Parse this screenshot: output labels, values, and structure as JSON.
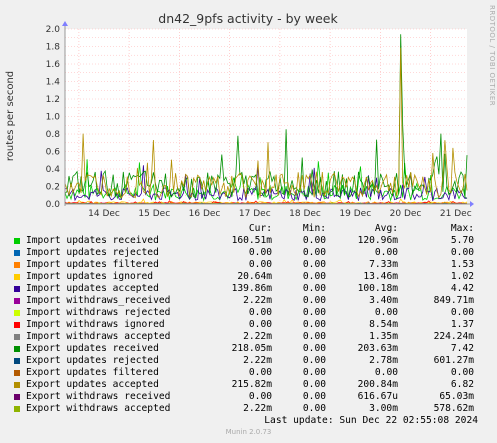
{
  "side_label": "RRDTOOL / TOBI OETIKER",
  "footer": "Munin 2.0.73",
  "chart_data": {
    "type": "line",
    "title": "dn42_9pfs activity - by week",
    "ylabel": "routes per second",
    "xlabel": "",
    "ylim": [
      0,
      2.0
    ],
    "yticks": [
      "0.0",
      "0.2",
      "0.4",
      "0.6",
      "0.8",
      "1.0",
      "1.2",
      "1.4",
      "1.6",
      "1.8",
      "2.0"
    ],
    "x_tick_labels": [
      "14 Dec",
      "15 Dec",
      "16 Dec",
      "17 Dec",
      "18 Dec",
      "19 Dec",
      "20 Dec",
      "21 Dec"
    ],
    "grid": true,
    "peak": {
      "date": "19 Dec 21:00",
      "value": 1.94
    },
    "legend_header": {
      "cur": "Cur:",
      "min": "Min:",
      "avg": "Avg:",
      "max": "Max:"
    },
    "series": [
      {
        "name": "Import updates received",
        "color": "#00cc00",
        "cur": "160.51m",
        "min": "0.00",
        "avg": "120.96m",
        "max": "5.70"
      },
      {
        "name": "Import updates rejected",
        "color": "#0066b3",
        "cur": "0.00",
        "min": "0.00",
        "avg": "0.00",
        "max": "0.00"
      },
      {
        "name": "Import updates filtered",
        "color": "#ff8000",
        "cur": "0.00",
        "min": "0.00",
        "avg": "7.33m",
        "max": "1.53"
      },
      {
        "name": "Import updates ignored",
        "color": "#ffcc00",
        "cur": "20.64m",
        "min": "0.00",
        "avg": "13.46m",
        "max": "1.02"
      },
      {
        "name": "Import updates accepted",
        "color": "#330099",
        "cur": "139.86m",
        "min": "0.00",
        "avg": "100.18m",
        "max": "4.42"
      },
      {
        "name": "Import withdraws_received",
        "color": "#990099",
        "cur": "2.22m",
        "min": "0.00",
        "avg": "3.40m",
        "max": "849.71m"
      },
      {
        "name": "Import withdraws rejected",
        "color": "#ccff00",
        "cur": "0.00",
        "min": "0.00",
        "avg": "0.00",
        "max": "0.00"
      },
      {
        "name": "Import withdraws ignored",
        "color": "#ff0000",
        "cur": "0.00",
        "min": "0.00",
        "avg": "8.54m",
        "max": "1.37"
      },
      {
        "name": "Import withdraws accepted",
        "color": "#808080",
        "cur": "2.22m",
        "min": "0.00",
        "avg": "1.35m",
        "max": "224.24m"
      },
      {
        "name": "Export updates received",
        "color": "#008f00",
        "cur": "218.05m",
        "min": "0.00",
        "avg": "203.63m",
        "max": "7.42"
      },
      {
        "name": "Export updates rejected",
        "color": "#00487d",
        "cur": "2.22m",
        "min": "0.00",
        "avg": "2.78m",
        "max": "601.27m"
      },
      {
        "name": "Export updates filtered",
        "color": "#b35a00",
        "cur": "0.00",
        "min": "0.00",
        "avg": "0.00",
        "max": "0.00"
      },
      {
        "name": "Export updates accepted",
        "color": "#b38f00",
        "cur": "215.82m",
        "min": "0.00",
        "avg": "200.84m",
        "max": "6.82"
      },
      {
        "name": "Export withdraws received",
        "color": "#6b006b",
        "cur": "0.00",
        "min": "0.00",
        "avg": "616.67u",
        "max": "65.03m"
      },
      {
        "name": "Export withdraws accepted",
        "color": "#8fb300",
        "cur": "2.22m",
        "min": "0.00",
        "avg": "3.00m",
        "max": "578.62m"
      }
    ],
    "last_update": "Last update: Sun Dec 22 02:55:08 2024"
  }
}
